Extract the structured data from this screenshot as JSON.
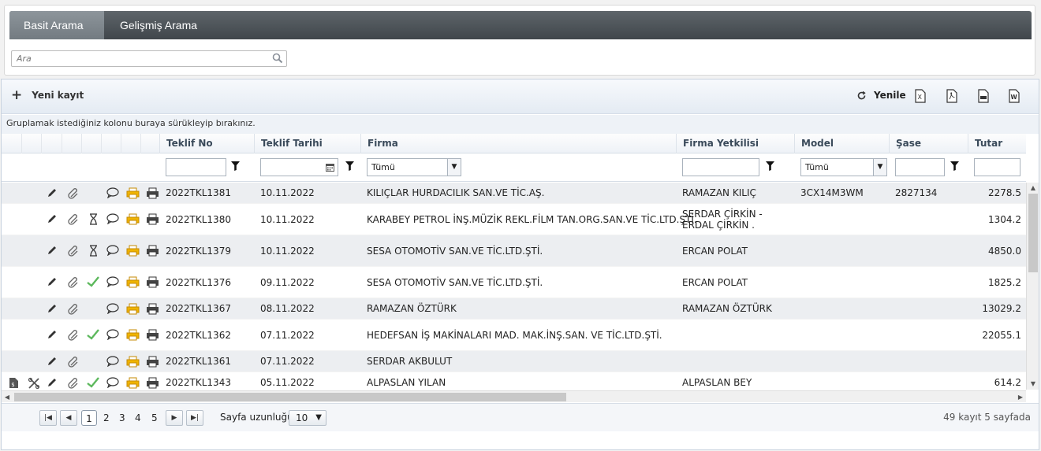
{
  "tabs": [
    {
      "label": "Basit Arama",
      "active": true
    },
    {
      "label": "Gelişmiş Arama",
      "active": false
    }
  ],
  "search": {
    "placeholder": "Ara"
  },
  "toolbar": {
    "new_label": "Yeni kayıt",
    "refresh_label": "Yenile",
    "exports": [
      "excel-icon",
      "pdf-icon",
      "csv-icon",
      "word-icon"
    ]
  },
  "group_hint": "Gruplamak istediğiniz kolonu buraya sürükleyip bırakınız.",
  "columns": {
    "teklif_no": "Teklif No",
    "teklif_tarihi": "Teklif Tarihi",
    "firma": "Firma",
    "firma_yetkilisi": "Firma Yetkilisi",
    "model": "Model",
    "sase": "Şase",
    "tutar": "Tutar"
  },
  "filters": {
    "firma_select": "Tümü",
    "model_select": "Tümü"
  },
  "rows": [
    {
      "no": "2022TKL1381",
      "date": "10.11.2022",
      "firma": "KILIÇLAR HURDACILIK SAN.VE TİC.AŞ.",
      "yetkili": "RAMAZAN KILIÇ",
      "model": "3CX14M3WM",
      "sase": "2827134",
      "tutar": "2278.5",
      "icons": {
        "doc": false,
        "tool": false,
        "hourglass": false,
        "check": false
      }
    },
    {
      "no": "2022TKL1380",
      "date": "10.11.2022",
      "firma": "KARABEY PETROL İNŞ.MÜZİK REKL.FİLM TAN.ORG.SAN.VE TİC.LTD.ŞTİ.",
      "yetkili": "SERDAR ÇİRKİN - ERDAL ÇİRKİN .",
      "model": "",
      "sase": "",
      "tutar": "1304.2",
      "icons": {
        "doc": false,
        "tool": false,
        "hourglass": true,
        "check": false
      }
    },
    {
      "no": "2022TKL1379",
      "date": "10.11.2022",
      "firma": "SESA OTOMOTİV SAN.VE TİC.LTD.ŞTİ.",
      "yetkili": "ERCAN POLAT",
      "model": "",
      "sase": "",
      "tutar": "4850.0",
      "icons": {
        "doc": false,
        "tool": false,
        "hourglass": true,
        "check": false
      }
    },
    {
      "no": "2022TKL1376",
      "date": "09.11.2022",
      "firma": "SESA OTOMOTİV SAN.VE TİC.LTD.ŞTİ.",
      "yetkili": "ERCAN POLAT",
      "model": "",
      "sase": "",
      "tutar": "1825.2",
      "icons": {
        "doc": false,
        "tool": false,
        "hourglass": false,
        "check": true
      }
    },
    {
      "no": "2022TKL1367",
      "date": "08.11.2022",
      "firma": "RAMAZAN ÖZTÜRK",
      "yetkili": "RAMAZAN ÖZTÜRK",
      "model": "",
      "sase": "",
      "tutar": "13029.2",
      "icons": {
        "doc": false,
        "tool": false,
        "hourglass": false,
        "check": false
      }
    },
    {
      "no": "2022TKL1362",
      "date": "07.11.2022",
      "firma": "HEDEFSAN İŞ MAKİNALARI MAD. MAK.İNŞ.SAN. VE TİC.LTD.ŞTİ.",
      "yetkili": "",
      "model": "",
      "sase": "",
      "tutar": "22055.1",
      "icons": {
        "doc": false,
        "tool": false,
        "hourglass": false,
        "check": true
      }
    },
    {
      "no": "2022TKL1361",
      "date": "07.11.2022",
      "firma": "SERDAR AKBULUT",
      "yetkili": "",
      "model": "",
      "sase": "",
      "tutar": "",
      "icons": {
        "doc": false,
        "tool": false,
        "hourglass": false,
        "check": false
      }
    },
    {
      "no": "2022TKL1343",
      "date": "05.11.2022",
      "firma": "ALPASLAN YILAN",
      "yetkili": "ALPASLAN BEY",
      "model": "",
      "sase": "",
      "tutar": "614.2",
      "icons": {
        "doc": true,
        "tool": true,
        "hourglass": false,
        "check": true
      }
    }
  ],
  "pager": {
    "pages": [
      "1",
      "2",
      "3",
      "4",
      "5"
    ],
    "current": "1",
    "size_label": "Sayfa uzunluğu:",
    "size_value": "10",
    "info": "49 kayıt 5 sayfada"
  }
}
